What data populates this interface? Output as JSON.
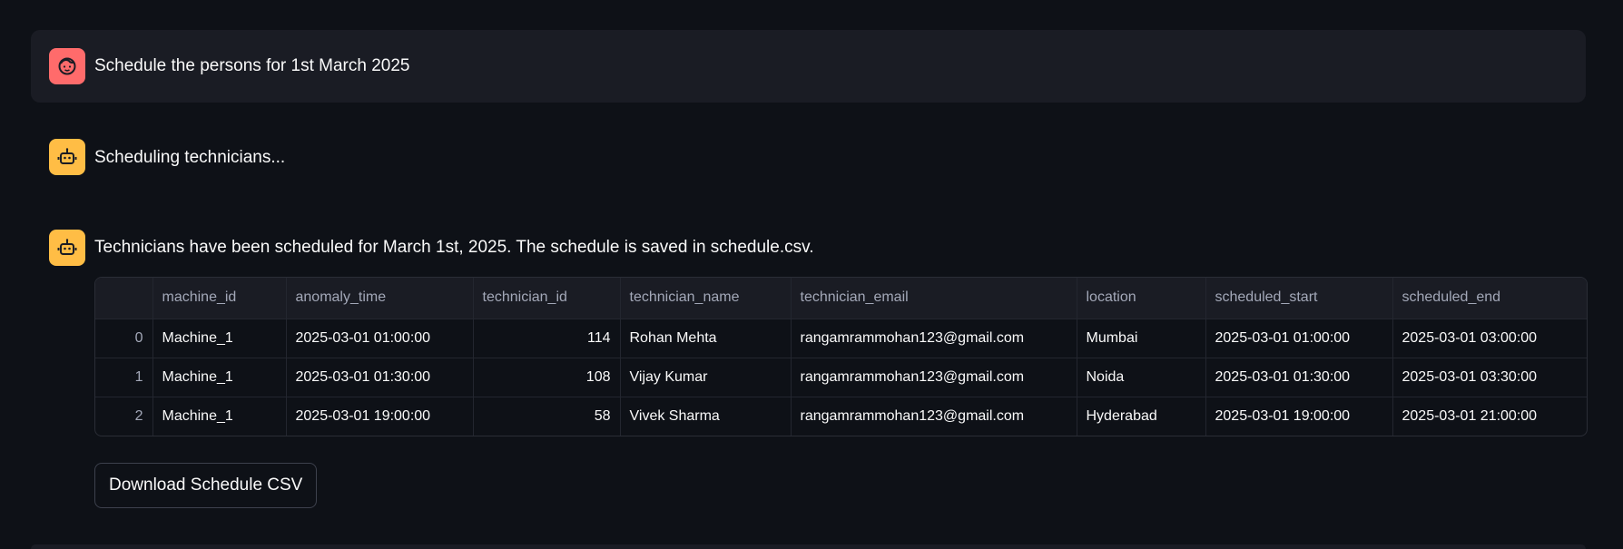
{
  "messages": {
    "user": {
      "avatar_icon": "face-icon",
      "text": "Schedule the persons for 1st March 2025"
    },
    "bot_status": {
      "avatar_icon": "robot-icon",
      "text": "Scheduling technicians..."
    },
    "bot_result": {
      "avatar_icon": "robot-icon",
      "text": "Technicians have been scheduled for March 1st, 2025. The schedule is saved in schedule.csv."
    }
  },
  "table": {
    "columns": [
      "",
      "machine_id",
      "anomaly_time",
      "technician_id",
      "technician_name",
      "technician_email",
      "location",
      "scheduled_start",
      "scheduled_end"
    ],
    "rows": [
      [
        "0",
        "Machine_1",
        "2025-03-01 01:00:00",
        "114",
        "Rohan Mehta",
        "rangamrammohan123@gmail.com",
        "Mumbai",
        "2025-03-01 01:00:00",
        "2025-03-01 03:00:00"
      ],
      [
        "1",
        "Machine_1",
        "2025-03-01 01:30:00",
        "108",
        "Vijay Kumar",
        "rangamrammohan123@gmail.com",
        "Noida",
        "2025-03-01 01:30:00",
        "2025-03-01 03:30:00"
      ],
      [
        "2",
        "Machine_1",
        "2025-03-01 19:00:00",
        "58",
        "Vivek Sharma",
        "rangamrammohan123@gmail.com",
        "Hyderabad",
        "2025-03-01 19:00:00",
        "2025-03-01 21:00:00"
      ]
    ]
  },
  "download_button": {
    "label": "Download Schedule CSV"
  },
  "colors": {
    "background": "#0e1117",
    "user_avatar": "#ff6b6b",
    "bot_avatar": "#ffbd45"
  }
}
